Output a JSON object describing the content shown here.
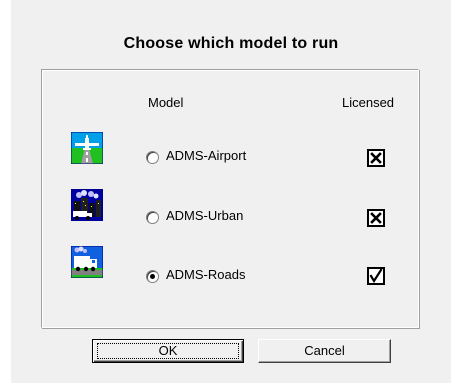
{
  "dialog": {
    "title": "Choose which model to run",
    "headers": {
      "model": "Model",
      "licensed": "Licensed"
    },
    "models": [
      {
        "label": "ADMS-Airport",
        "icon": "airport-icon",
        "selected": false,
        "license_state": "unlicensed"
      },
      {
        "label": "ADMS-Urban",
        "icon": "urban-icon",
        "selected": false,
        "license_state": "unlicensed"
      },
      {
        "label": "ADMS-Roads",
        "icon": "roads-icon",
        "selected": true,
        "license_state": "licensed"
      }
    ],
    "buttons": {
      "ok": "OK",
      "cancel": "Cancel"
    }
  }
}
